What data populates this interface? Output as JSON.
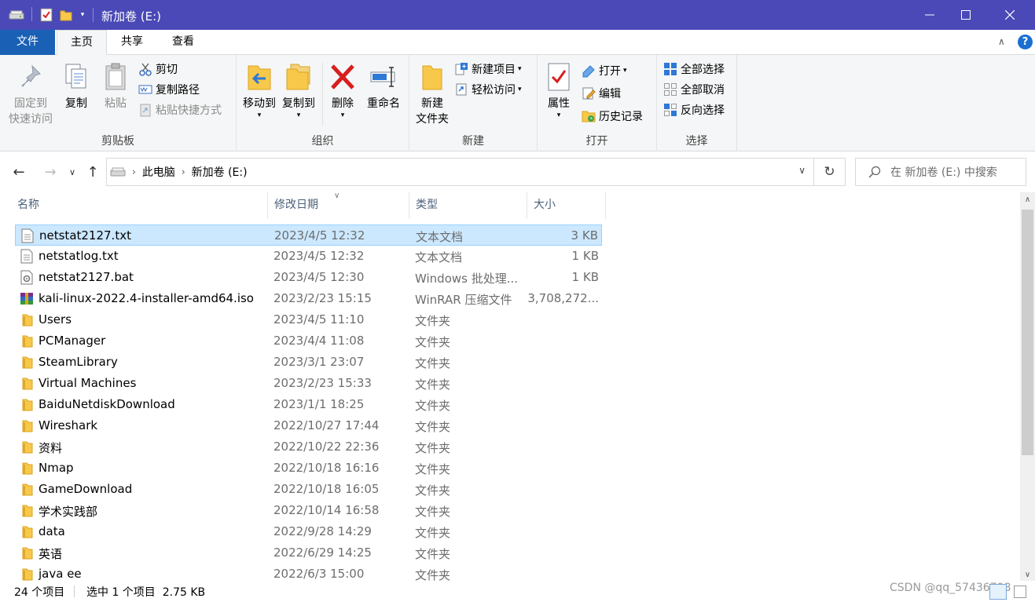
{
  "window": {
    "title": "新加卷 (E:)"
  },
  "tabs": {
    "file": "文件",
    "home": "主页",
    "share": "共享",
    "view": "查看"
  },
  "ribbon": {
    "clipboard": {
      "pin_l1": "固定到",
      "pin_l2": "快速访问",
      "copy": "复制",
      "paste": "粘贴",
      "cut": "剪切",
      "copy_path": "复制路径",
      "paste_shortcut": "粘贴快捷方式",
      "label": "剪贴板"
    },
    "organize": {
      "move_to": "移动到",
      "copy_to": "复制到",
      "delete": "删除",
      "rename": "重命名",
      "label": "组织"
    },
    "new": {
      "new_folder_l1": "新建",
      "new_folder_l2": "文件夹",
      "new_item": "新建项目",
      "easy_access": "轻松访问",
      "label": "新建"
    },
    "open": {
      "properties": "属性",
      "open": "打开",
      "edit": "编辑",
      "history": "历史记录",
      "label": "打开"
    },
    "select": {
      "select_all": "全部选择",
      "select_none": "全部取消",
      "invert": "反向选择",
      "label": "选择"
    }
  },
  "address": {
    "crumb1": "此电脑",
    "crumb2": "新加卷 (E:)",
    "search_placeholder": "在 新加卷 (E:) 中搜索"
  },
  "columns": {
    "name": "名称",
    "date": "修改日期",
    "type": "类型",
    "size": "大小"
  },
  "files": [
    {
      "name": "netstat2127.txt",
      "date": "2023/4/5 12:32",
      "type": "文本文档",
      "size": "3 KB",
      "icon": "text-file-icon",
      "selected": true
    },
    {
      "name": "netstatlog.txt",
      "date": "2023/4/5 12:32",
      "type": "文本文档",
      "size": "1 KB",
      "icon": "text-file-icon"
    },
    {
      "name": "netstat2127.bat",
      "date": "2023/4/5 12:30",
      "type": "Windows 批处理...",
      "size": "1 KB",
      "icon": "batch-file-icon"
    },
    {
      "name": "kali-linux-2022.4-installer-amd64.iso",
      "date": "2023/2/23 15:15",
      "type": "WinRAR 压缩文件",
      "size": "3,708,272...",
      "icon": "winrar-archive-icon"
    },
    {
      "name": "Users",
      "date": "2023/4/5 11:10",
      "type": "文件夹",
      "size": "",
      "icon": "folder-icon"
    },
    {
      "name": "PCManager",
      "date": "2023/4/4 11:08",
      "type": "文件夹",
      "size": "",
      "icon": "folder-icon"
    },
    {
      "name": "SteamLibrary",
      "date": "2023/3/1 23:07",
      "type": "文件夹",
      "size": "",
      "icon": "folder-icon"
    },
    {
      "name": "Virtual Machines",
      "date": "2023/2/23 15:33",
      "type": "文件夹",
      "size": "",
      "icon": "folder-icon"
    },
    {
      "name": "BaiduNetdiskDownload",
      "date": "2023/1/1 18:25",
      "type": "文件夹",
      "size": "",
      "icon": "folder-icon"
    },
    {
      "name": "Wireshark",
      "date": "2022/10/27 17:44",
      "type": "文件夹",
      "size": "",
      "icon": "folder-icon"
    },
    {
      "name": "资料",
      "date": "2022/10/22 22:36",
      "type": "文件夹",
      "size": "",
      "icon": "folder-icon"
    },
    {
      "name": "Nmap",
      "date": "2022/10/18 16:16",
      "type": "文件夹",
      "size": "",
      "icon": "folder-icon"
    },
    {
      "name": "GameDownload",
      "date": "2022/10/18 16:05",
      "type": "文件夹",
      "size": "",
      "icon": "folder-icon"
    },
    {
      "name": "学术实践部",
      "date": "2022/10/14 16:58",
      "type": "文件夹",
      "size": "",
      "icon": "folder-icon"
    },
    {
      "name": "data",
      "date": "2022/9/28 14:29",
      "type": "文件夹",
      "size": "",
      "icon": "folder-icon"
    },
    {
      "name": "英语",
      "date": "2022/6/29 14:25",
      "type": "文件夹",
      "size": "",
      "icon": "folder-icon"
    },
    {
      "name": "java ee",
      "date": "2022/6/3 15:00",
      "type": "文件夹",
      "size": "",
      "icon": "folder-icon"
    }
  ],
  "status": {
    "count": "24 个项目",
    "selection": "选中 1 个项目  2.75 KB",
    "watermark": "CSDN @qq_57436798"
  },
  "colors": {
    "titlebar": "#4a49b7",
    "file_tab": "#1a61b5",
    "selection": "#cce8ff",
    "folder": "#f8c84a"
  }
}
